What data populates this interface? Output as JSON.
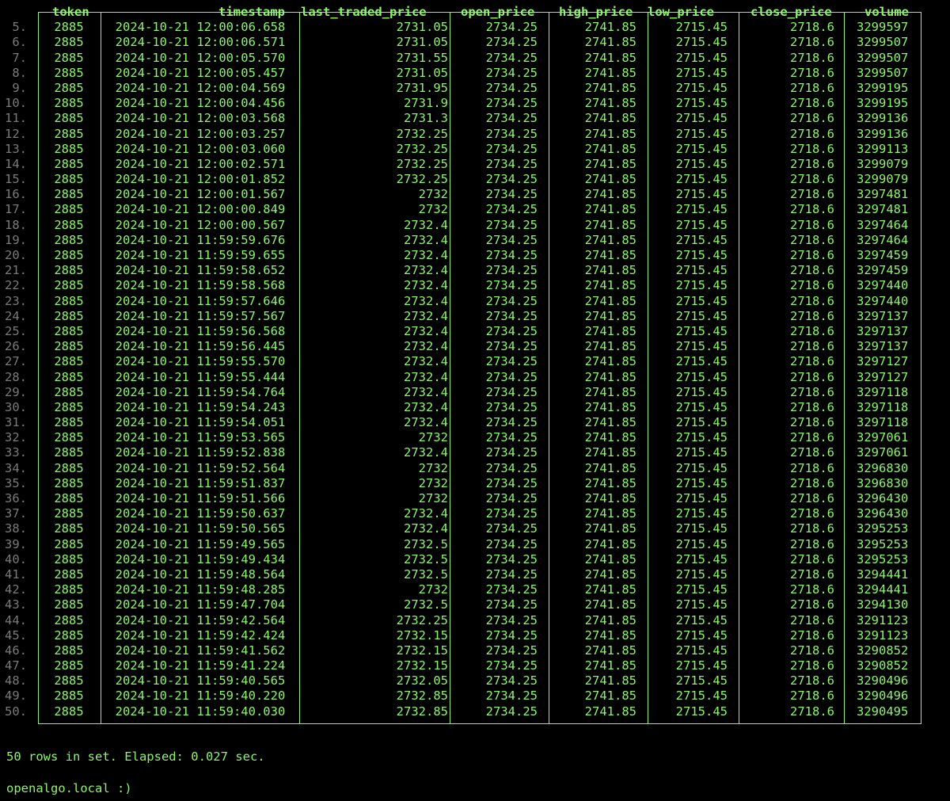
{
  "columns": [
    "token",
    "timestamp",
    "last_traded_price",
    "open_price",
    "high_price",
    "low_price",
    "close_price",
    "volume"
  ],
  "rows": [
    [
      "5.",
      "2885",
      "2024-10-21 12:00:06.658",
      "2731.05",
      "2734.25",
      "2741.85",
      "2715.45",
      "2718.6",
      "3299597"
    ],
    [
      "6.",
      "2885",
      "2024-10-21 12:00:06.571",
      "2731.05",
      "2734.25",
      "2741.85",
      "2715.45",
      "2718.6",
      "3299507"
    ],
    [
      "7.",
      "2885",
      "2024-10-21 12:00:05.570",
      "2731.55",
      "2734.25",
      "2741.85",
      "2715.45",
      "2718.6",
      "3299507"
    ],
    [
      "8.",
      "2885",
      "2024-10-21 12:00:05.457",
      "2731.05",
      "2734.25",
      "2741.85",
      "2715.45",
      "2718.6",
      "3299507"
    ],
    [
      "9.",
      "2885",
      "2024-10-21 12:00:04.569",
      "2731.95",
      "2734.25",
      "2741.85",
      "2715.45",
      "2718.6",
      "3299195"
    ],
    [
      "10.",
      "2885",
      "2024-10-21 12:00:04.456",
      "2731.9",
      "2734.25",
      "2741.85",
      "2715.45",
      "2718.6",
      "3299195"
    ],
    [
      "11.",
      "2885",
      "2024-10-21 12:00:03.568",
      "2731.3",
      "2734.25",
      "2741.85",
      "2715.45",
      "2718.6",
      "3299136"
    ],
    [
      "12.",
      "2885",
      "2024-10-21 12:00:03.257",
      "2732.25",
      "2734.25",
      "2741.85",
      "2715.45",
      "2718.6",
      "3299136"
    ],
    [
      "13.",
      "2885",
      "2024-10-21 12:00:03.060",
      "2732.25",
      "2734.25",
      "2741.85",
      "2715.45",
      "2718.6",
      "3299113"
    ],
    [
      "14.",
      "2885",
      "2024-10-21 12:00:02.571",
      "2732.25",
      "2734.25",
      "2741.85",
      "2715.45",
      "2718.6",
      "3299079"
    ],
    [
      "15.",
      "2885",
      "2024-10-21 12:00:01.852",
      "2732.25",
      "2734.25",
      "2741.85",
      "2715.45",
      "2718.6",
      "3299079"
    ],
    [
      "16.",
      "2885",
      "2024-10-21 12:00:01.567",
      "2732",
      "2734.25",
      "2741.85",
      "2715.45",
      "2718.6",
      "3297481"
    ],
    [
      "17.",
      "2885",
      "2024-10-21 12:00:00.849",
      "2732",
      "2734.25",
      "2741.85",
      "2715.45",
      "2718.6",
      "3297481"
    ],
    [
      "18.",
      "2885",
      "2024-10-21 12:00:00.567",
      "2732.4",
      "2734.25",
      "2741.85",
      "2715.45",
      "2718.6",
      "3297464"
    ],
    [
      "19.",
      "2885",
      "2024-10-21 11:59:59.676",
      "2732.4",
      "2734.25",
      "2741.85",
      "2715.45",
      "2718.6",
      "3297464"
    ],
    [
      "20.",
      "2885",
      "2024-10-21 11:59:59.655",
      "2732.4",
      "2734.25",
      "2741.85",
      "2715.45",
      "2718.6",
      "3297459"
    ],
    [
      "21.",
      "2885",
      "2024-10-21 11:59:58.652",
      "2732.4",
      "2734.25",
      "2741.85",
      "2715.45",
      "2718.6",
      "3297459"
    ],
    [
      "22.",
      "2885",
      "2024-10-21 11:59:58.568",
      "2732.4",
      "2734.25",
      "2741.85",
      "2715.45",
      "2718.6",
      "3297440"
    ],
    [
      "23.",
      "2885",
      "2024-10-21 11:59:57.646",
      "2732.4",
      "2734.25",
      "2741.85",
      "2715.45",
      "2718.6",
      "3297440"
    ],
    [
      "24.",
      "2885",
      "2024-10-21 11:59:57.567",
      "2732.4",
      "2734.25",
      "2741.85",
      "2715.45",
      "2718.6",
      "3297137"
    ],
    [
      "25.",
      "2885",
      "2024-10-21 11:59:56.568",
      "2732.4",
      "2734.25",
      "2741.85",
      "2715.45",
      "2718.6",
      "3297137"
    ],
    [
      "26.",
      "2885",
      "2024-10-21 11:59:56.445",
      "2732.4",
      "2734.25",
      "2741.85",
      "2715.45",
      "2718.6",
      "3297137"
    ],
    [
      "27.",
      "2885",
      "2024-10-21 11:59:55.570",
      "2732.4",
      "2734.25",
      "2741.85",
      "2715.45",
      "2718.6",
      "3297127"
    ],
    [
      "28.",
      "2885",
      "2024-10-21 11:59:55.444",
      "2732.4",
      "2734.25",
      "2741.85",
      "2715.45",
      "2718.6",
      "3297127"
    ],
    [
      "29.",
      "2885",
      "2024-10-21 11:59:54.764",
      "2732.4",
      "2734.25",
      "2741.85",
      "2715.45",
      "2718.6",
      "3297118"
    ],
    [
      "30.",
      "2885",
      "2024-10-21 11:59:54.243",
      "2732.4",
      "2734.25",
      "2741.85",
      "2715.45",
      "2718.6",
      "3297118"
    ],
    [
      "31.",
      "2885",
      "2024-10-21 11:59:54.051",
      "2732.4",
      "2734.25",
      "2741.85",
      "2715.45",
      "2718.6",
      "3297118"
    ],
    [
      "32.",
      "2885",
      "2024-10-21 11:59:53.565",
      "2732",
      "2734.25",
      "2741.85",
      "2715.45",
      "2718.6",
      "3297061"
    ],
    [
      "33.",
      "2885",
      "2024-10-21 11:59:52.838",
      "2732.4",
      "2734.25",
      "2741.85",
      "2715.45",
      "2718.6",
      "3297061"
    ],
    [
      "34.",
      "2885",
      "2024-10-21 11:59:52.564",
      "2732",
      "2734.25",
      "2741.85",
      "2715.45",
      "2718.6",
      "3296830"
    ],
    [
      "35.",
      "2885",
      "2024-10-21 11:59:51.837",
      "2732",
      "2734.25",
      "2741.85",
      "2715.45",
      "2718.6",
      "3296830"
    ],
    [
      "36.",
      "2885",
      "2024-10-21 11:59:51.566",
      "2732",
      "2734.25",
      "2741.85",
      "2715.45",
      "2718.6",
      "3296430"
    ],
    [
      "37.",
      "2885",
      "2024-10-21 11:59:50.637",
      "2732.4",
      "2734.25",
      "2741.85",
      "2715.45",
      "2718.6",
      "3296430"
    ],
    [
      "38.",
      "2885",
      "2024-10-21 11:59:50.565",
      "2732.4",
      "2734.25",
      "2741.85",
      "2715.45",
      "2718.6",
      "3295253"
    ],
    [
      "39.",
      "2885",
      "2024-10-21 11:59:49.565",
      "2732.5",
      "2734.25",
      "2741.85",
      "2715.45",
      "2718.6",
      "3295253"
    ],
    [
      "40.",
      "2885",
      "2024-10-21 11:59:49.434",
      "2732.5",
      "2734.25",
      "2741.85",
      "2715.45",
      "2718.6",
      "3295253"
    ],
    [
      "41.",
      "2885",
      "2024-10-21 11:59:48.564",
      "2732.5",
      "2734.25",
      "2741.85",
      "2715.45",
      "2718.6",
      "3294441"
    ],
    [
      "42.",
      "2885",
      "2024-10-21 11:59:48.285",
      "2732",
      "2734.25",
      "2741.85",
      "2715.45",
      "2718.6",
      "3294441"
    ],
    [
      "43.",
      "2885",
      "2024-10-21 11:59:47.704",
      "2732.5",
      "2734.25",
      "2741.85",
      "2715.45",
      "2718.6",
      "3294130"
    ],
    [
      "44.",
      "2885",
      "2024-10-21 11:59:42.564",
      "2732.25",
      "2734.25",
      "2741.85",
      "2715.45",
      "2718.6",
      "3291123"
    ],
    [
      "45.",
      "2885",
      "2024-10-21 11:59:42.424",
      "2732.15",
      "2734.25",
      "2741.85",
      "2715.45",
      "2718.6",
      "3291123"
    ],
    [
      "46.",
      "2885",
      "2024-10-21 11:59:41.562",
      "2732.15",
      "2734.25",
      "2741.85",
      "2715.45",
      "2718.6",
      "3290852"
    ],
    [
      "47.",
      "2885",
      "2024-10-21 11:59:41.224",
      "2732.15",
      "2734.25",
      "2741.85",
      "2715.45",
      "2718.6",
      "3290852"
    ],
    [
      "48.",
      "2885",
      "2024-10-21 11:59:40.565",
      "2732.05",
      "2734.25",
      "2741.85",
      "2715.45",
      "2718.6",
      "3290496"
    ],
    [
      "49.",
      "2885",
      "2024-10-21 11:59:40.220",
      "2732.85",
      "2734.25",
      "2741.85",
      "2715.45",
      "2718.6",
      "3290496"
    ],
    [
      "50.",
      "2885",
      "2024-10-21 11:59:40.030",
      "2732.85",
      "2734.25",
      "2741.85",
      "2715.45",
      "2718.6",
      "3290495"
    ]
  ],
  "footer": {
    "summary": "50 rows in set. Elapsed: 0.027 sec.",
    "prompt": "openalgo.local :)"
  },
  "colors": {
    "text": "#8df56a",
    "rownum": "#7a7a7a",
    "background": "#000000"
  }
}
